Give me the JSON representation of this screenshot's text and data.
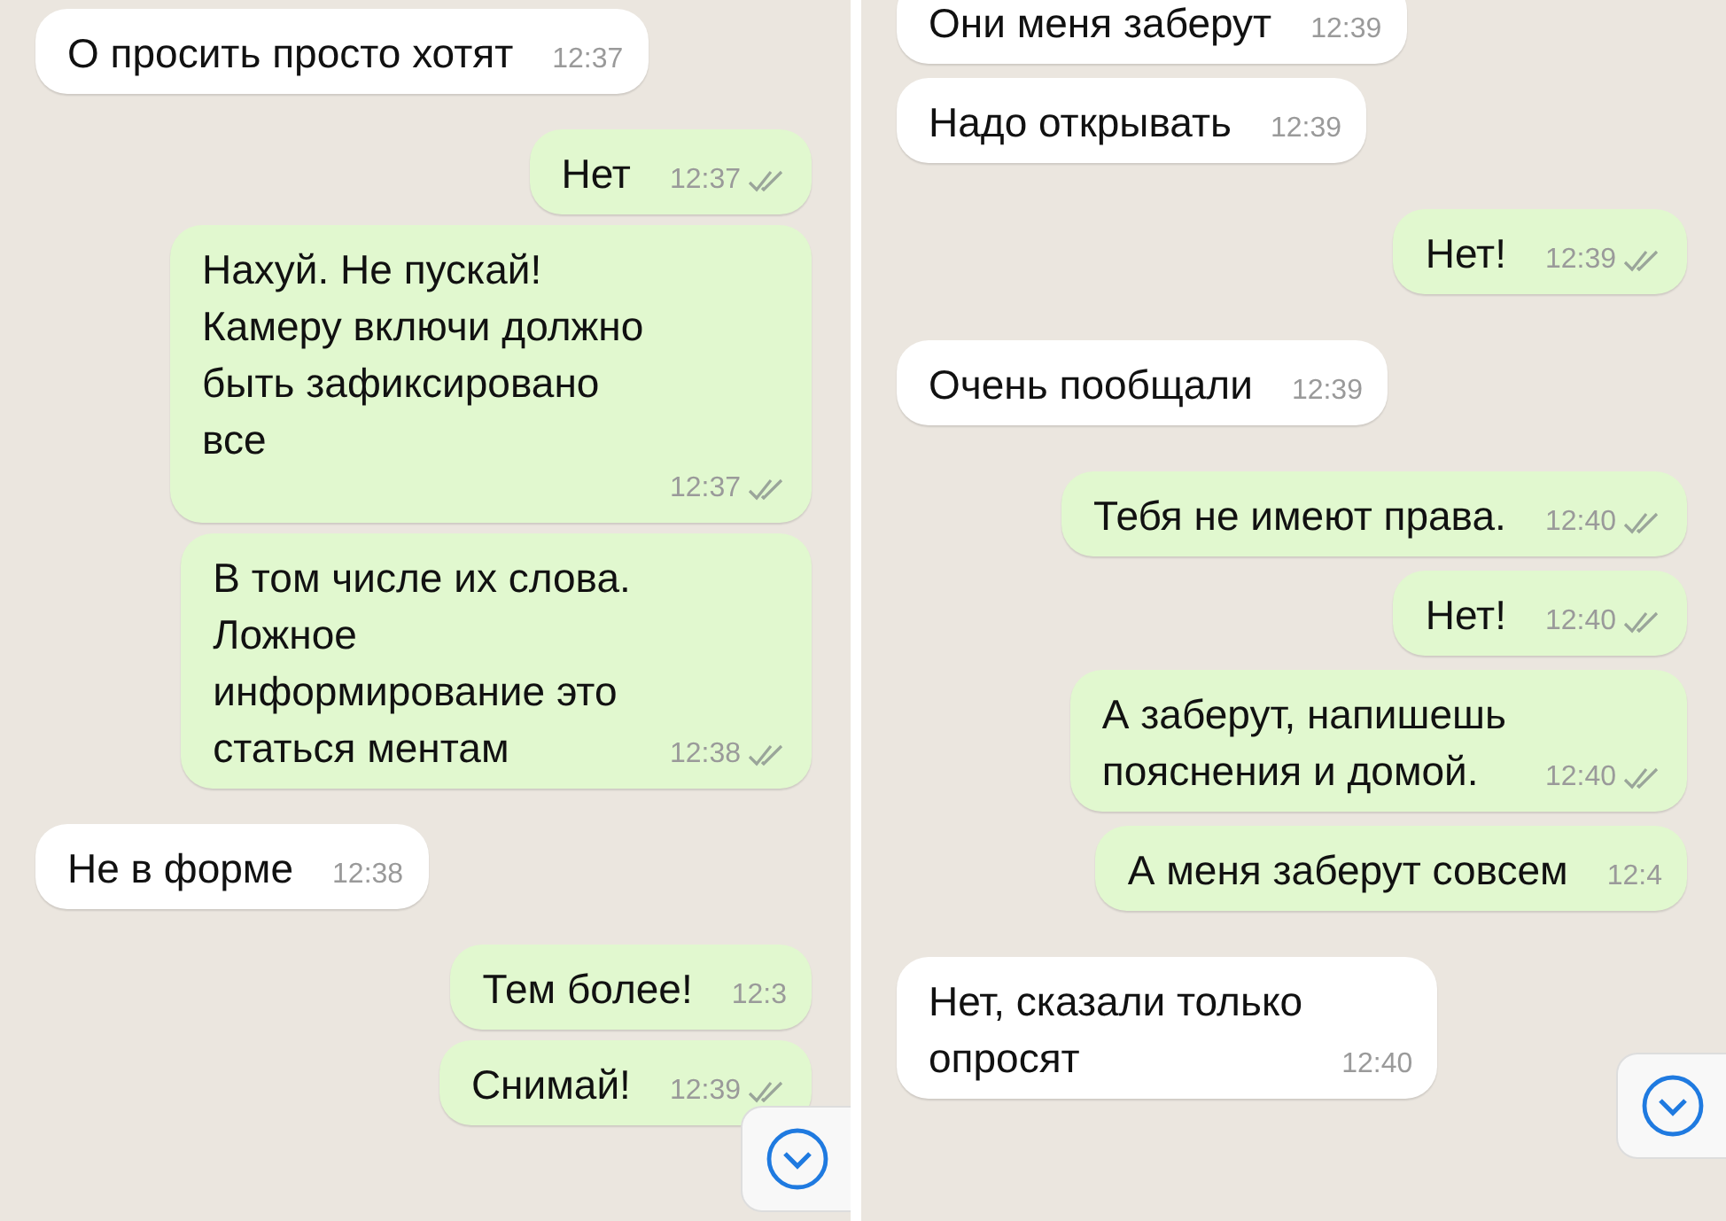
{
  "panels": [
    {
      "messages": [
        {
          "kind": "in",
          "text": "О просить просто хотят",
          "time": "12:37",
          "ticks": false
        },
        {
          "kind": "out",
          "text": "Нет",
          "time": "12:37",
          "ticks": true
        },
        {
          "kind": "out",
          "text": "Нахуй. Не пускай!\nКамеру включи должно\nбыть зафиксировано\nвсе",
          "time": "12:37",
          "ticks": true
        },
        {
          "kind": "out",
          "text": "В том числе их слова.\nЛожное\nинформирование это\nстаться ментам",
          "time": "12:38",
          "ticks": true
        },
        {
          "kind": "in",
          "text": "Не в форме",
          "time": "12:38",
          "ticks": false
        },
        {
          "kind": "out",
          "text": "Тем более!",
          "time": "12:3",
          "ticks": false
        },
        {
          "kind": "out",
          "text": "Снимай!",
          "time": "12:39",
          "ticks": true
        }
      ],
      "scroll_button": true
    },
    {
      "messages": [
        {
          "kind": "in",
          "text": "Они меня заберут",
          "time": "12:39",
          "ticks": false
        },
        {
          "kind": "in",
          "text": "Надо открывать",
          "time": "12:39",
          "ticks": false
        },
        {
          "kind": "out",
          "text": "Нет!",
          "time": "12:39",
          "ticks": true
        },
        {
          "kind": "in",
          "text": "Очень пообщали",
          "time": "12:39",
          "ticks": false
        },
        {
          "kind": "out",
          "text": "Тебя не имеют права.",
          "time": "12:40",
          "ticks": true
        },
        {
          "kind": "out",
          "text": "Нет!",
          "time": "12:40",
          "ticks": true
        },
        {
          "kind": "out",
          "text": "А заберут, напишешь\nпояснения и домой.",
          "time": "12:40",
          "ticks": true
        },
        {
          "kind": "out",
          "text": "А меня заберут совсем",
          "time": "12:4",
          "ticks": false
        },
        {
          "kind": "in",
          "text": "Нет, сказали только\nопросят",
          "time": "12:40",
          "ticks": false
        }
      ],
      "scroll_button": true
    }
  ]
}
